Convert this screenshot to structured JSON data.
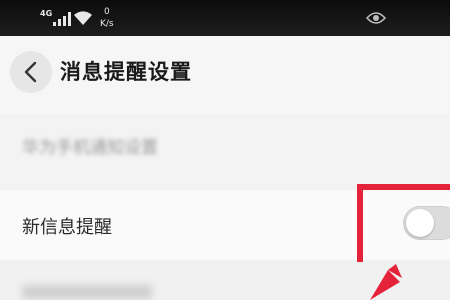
{
  "status_bar": {
    "network_type": "4G",
    "speed_value": "0",
    "speed_unit": "K/s"
  },
  "header": {
    "title": "消息提醒设置"
  },
  "settings": {
    "section_label": "华为手机通知设置",
    "items": [
      {
        "label": "新信息提醒",
        "toggle_on": false
      }
    ]
  },
  "colors": {
    "highlight": "#e4233b",
    "status_bar_bg": "#111111",
    "page_bg": "#f2f2f2"
  },
  "icons": [
    "signal-icon",
    "wifi-icon",
    "eye-icon",
    "back-arrow-icon"
  ]
}
